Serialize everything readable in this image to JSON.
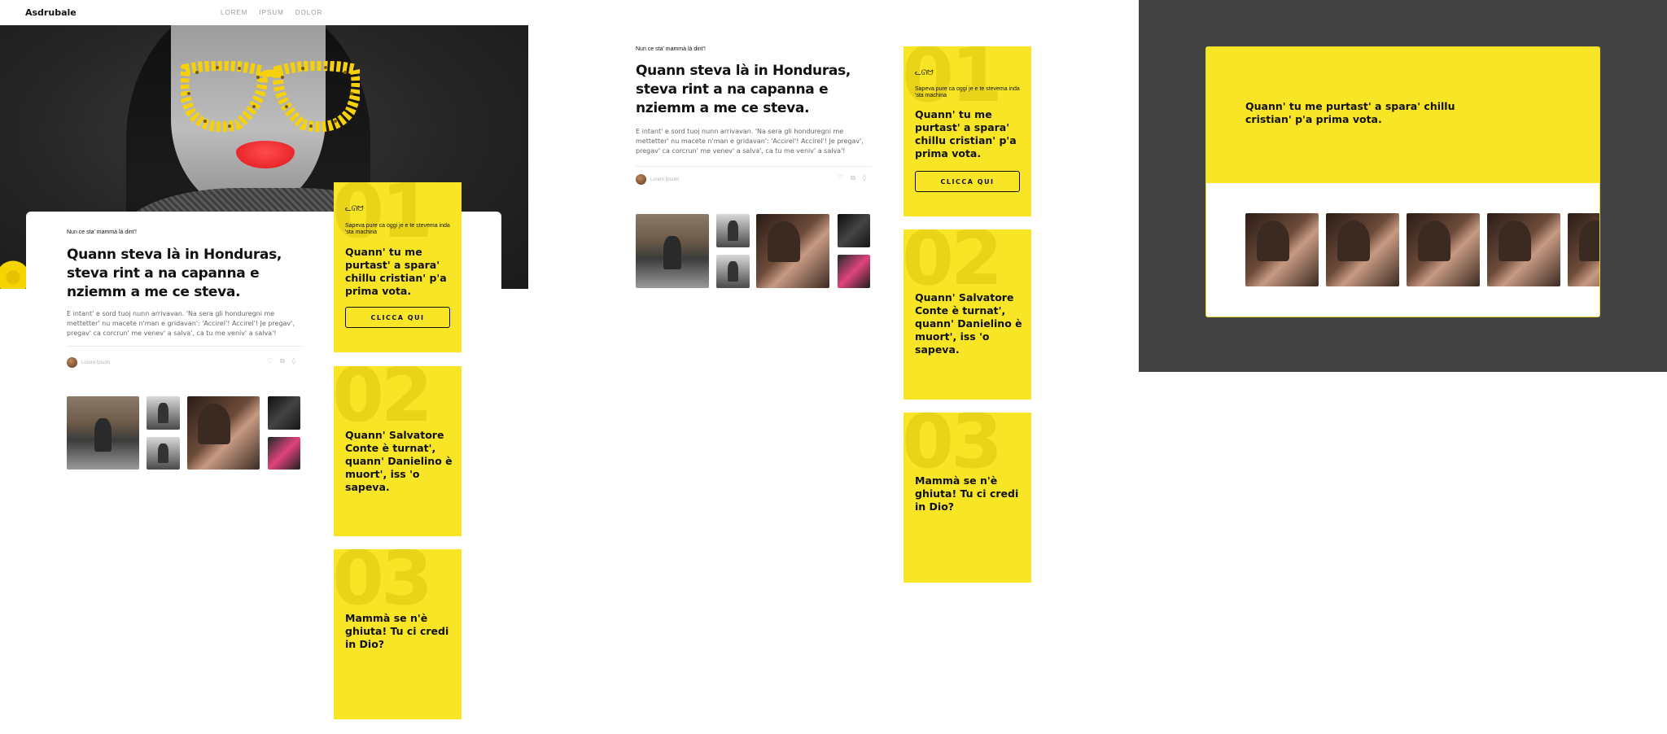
{
  "brand": "Asdrubale",
  "nav": {
    "items": [
      "LOREM",
      "IPSUM",
      "DOLOR"
    ]
  },
  "article": {
    "eyebrow": "Nun ce sta' mammà là dint'!",
    "title": "Quann steva là in Honduras, steva rint a na capanna e nziemm a me ce steva.",
    "body": "E intant' e sord tuoj nunn arrivavan. 'Na sera gli honduregni me mettetter' nu macete n'man e gridavan': 'Accirel'! Accirel'! Je pregav', pregav' ca corcrun' me venev' a salva', ca tu me veniv' a salva'!",
    "author": "Lorem Ipsum",
    "action_icons": [
      "like-icon",
      "share-icon",
      "bookmark-icon"
    ]
  },
  "tiles": [
    {
      "number": "01",
      "icon": "cat-icon",
      "small": "Sapeva pure ca oggi je e te stevema inda 'sta machina",
      "heading": "Quann' tu me purtast' a spara' chillu cristian' p'a prima vota.",
      "button": "CLICCA QUI"
    },
    {
      "number": "02",
      "heading": "Quann' Salvatore Conte è turnat', quann' Danielino è muort', iss 'o sapeva."
    },
    {
      "number": "03",
      "heading": "Mammà se n'è ghiuta! Tu ci credi in Dio?"
    }
  ],
  "modal": {
    "heading": "Quann' tu me purtast' a spara' chillu cristian' p'a prima vota."
  },
  "colors": {
    "accent": "#f8e526",
    "dark_backdrop": "#434343",
    "text": "#111111"
  }
}
